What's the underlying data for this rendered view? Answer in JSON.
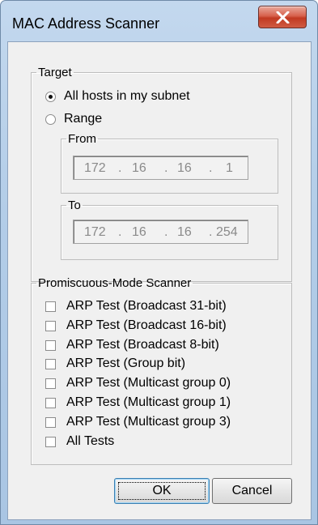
{
  "window": {
    "title": "MAC Address Scanner"
  },
  "target": {
    "legend": "Target",
    "all_hosts_label": "All hosts in my subnet",
    "range_label": "Range",
    "selected": "All hosts in my subnet",
    "from": {
      "legend": "From",
      "octets": [
        "172",
        "16",
        "16",
        "1"
      ]
    },
    "to": {
      "legend": "To",
      "octets": [
        "172",
        "16",
        "16",
        "254"
      ]
    }
  },
  "promiscuous": {
    "legend": "Promiscuous-Mode Scanner",
    "items": [
      {
        "label": "ARP Test (Broadcast 31-bit)",
        "checked": false
      },
      {
        "label": "ARP Test (Broadcast 16-bit)",
        "checked": false
      },
      {
        "label": "ARP Test (Broadcast 8-bit)",
        "checked": false
      },
      {
        "label": "ARP Test (Group bit)",
        "checked": false
      },
      {
        "label": "ARP Test (Multicast group 0)",
        "checked": false
      },
      {
        "label": "ARP Test (Multicast group 1)",
        "checked": false
      },
      {
        "label": "ARP Test (Multicast group 3)",
        "checked": false
      },
      {
        "label": "All Tests",
        "checked": false
      }
    ]
  },
  "buttons": {
    "ok": "OK",
    "cancel": "Cancel"
  },
  "colors": {
    "close_button": "#c13a22",
    "dialog_face": "#f0f0f0",
    "frame": "#b3cde8"
  }
}
